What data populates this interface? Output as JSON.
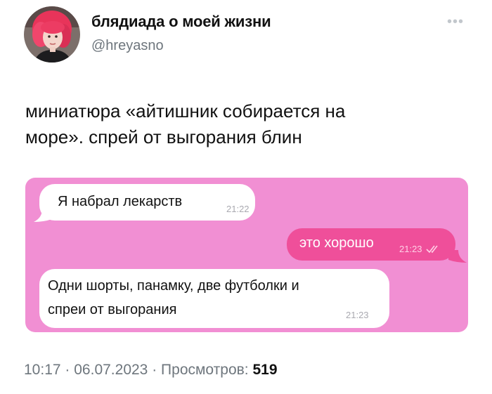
{
  "author": {
    "display_name": "блядиада о моей жизни",
    "handle": "@hreyasno",
    "more_icon": "more-dots-icon",
    "avatar": "avatar-photo-pink-hair"
  },
  "tweet": {
    "line1": "миниатюра «айтишник собирается на",
    "line2": "море». спрей от выгорания блин"
  },
  "chat": {
    "background_color": "#f18fd3",
    "outgoing_color": "#ef4f9a",
    "messages": [
      {
        "direction": "incoming",
        "lines": [
          "Я набрал лекарств"
        ],
        "time": "21:22"
      },
      {
        "direction": "outgoing",
        "lines": [
          "это хорошо"
        ],
        "time": "21:23",
        "status_icon": "double-check-icon"
      },
      {
        "direction": "incoming",
        "lines": [
          "Одни шорты, панамку, две футболки и",
          "спреи от выгорания"
        ],
        "time": "21:23"
      }
    ]
  },
  "footer": {
    "time": "10:17",
    "separator1": "·",
    "date": "06.07.2023",
    "separator2": "·",
    "views_label": "Просмотров:",
    "views_count": "519"
  }
}
